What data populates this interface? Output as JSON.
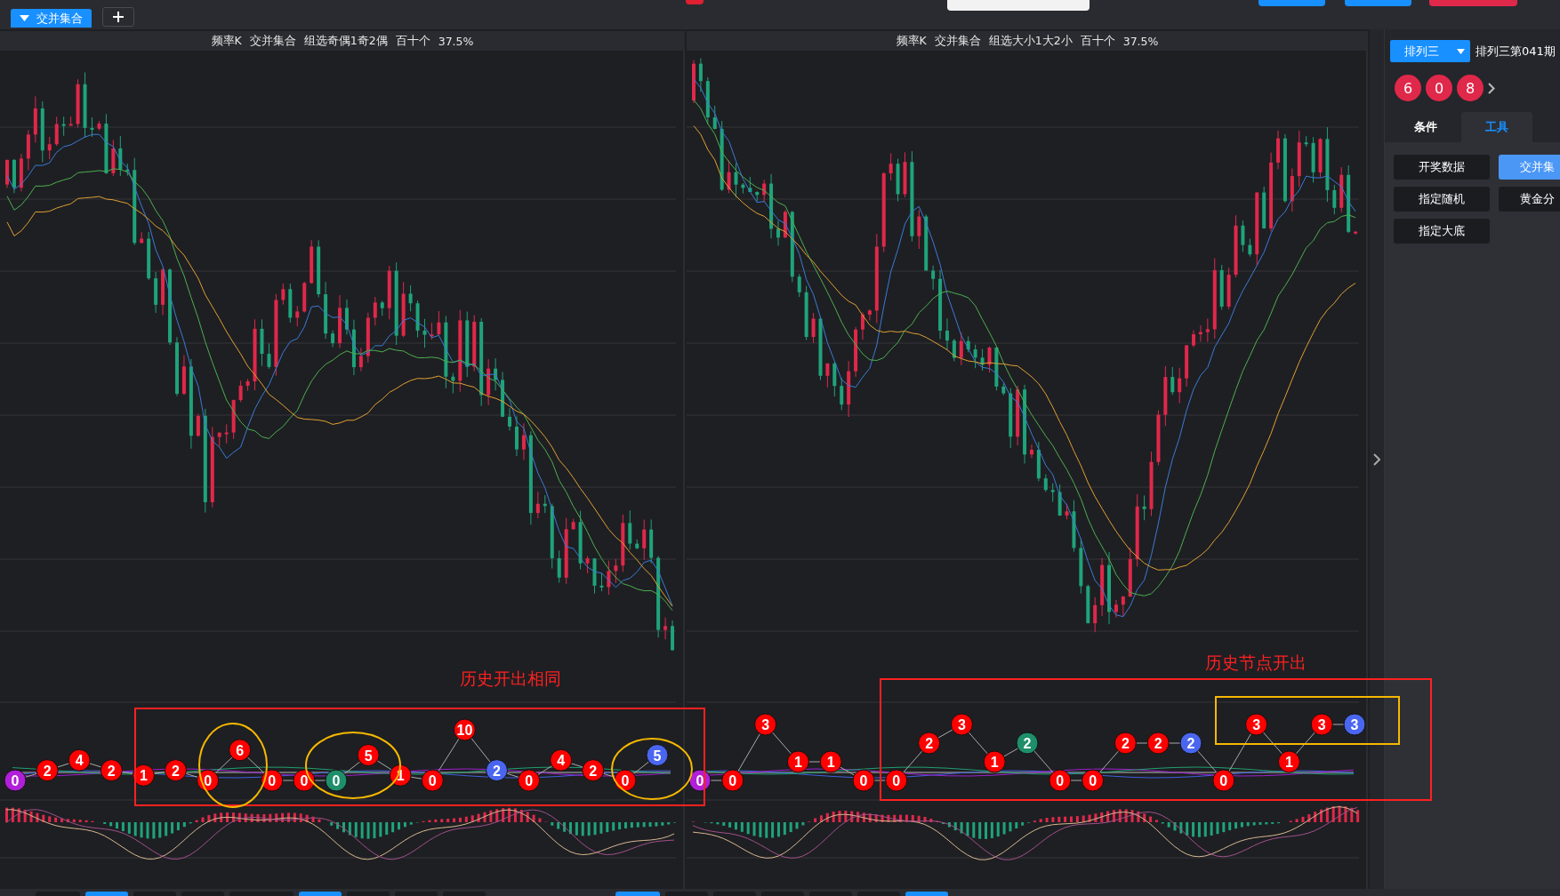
{
  "top_tabs": [
    {
      "label": "交并集合",
      "selected": true
    }
  ],
  "panels": [
    {
      "title_parts": [
        "频率K",
        "交并集合",
        "组选奇偶1奇2偶",
        "百十个",
        "37.5%"
      ],
      "nodes": [
        {
          "label": "0",
          "color": "#b11fd8"
        },
        {
          "label": "2",
          "color": "#ff0000"
        },
        {
          "label": "4",
          "color": "#ff0000"
        },
        {
          "label": "2",
          "color": "#ff0000"
        },
        {
          "label": "1",
          "color": "#ff0000"
        },
        {
          "label": "2",
          "color": "#ff0000"
        },
        {
          "label": "0",
          "color": "#ff0000"
        },
        {
          "label": "6",
          "color": "#ff0000"
        },
        {
          "label": "0",
          "color": "#ff0000"
        },
        {
          "label": "0",
          "color": "#ff0000"
        },
        {
          "label": "0",
          "color": "#1e8f6a"
        },
        {
          "label": "5",
          "color": "#ff0000"
        },
        {
          "label": "1",
          "color": "#ff0000"
        },
        {
          "label": "0",
          "color": "#ff0000"
        },
        {
          "label": "10",
          "color": "#ff0000"
        },
        {
          "label": "2",
          "color": "#4a66f0"
        },
        {
          "label": "0",
          "color": "#ff0000"
        },
        {
          "label": "4",
          "color": "#ff0000"
        },
        {
          "label": "2",
          "color": "#ff0000"
        },
        {
          "label": "0",
          "color": "#ff0000"
        },
        {
          "label": "5",
          "color": "#4a66f0"
        }
      ]
    },
    {
      "title_parts": [
        "频率K",
        "交并集合",
        "组选大小1大2小",
        "百十个",
        "37.5%"
      ],
      "nodes": [
        {
          "label": "0",
          "color": "#b11fd8"
        },
        {
          "label": "0",
          "color": "#ff0000"
        },
        {
          "label": "3",
          "color": "#ff0000"
        },
        {
          "label": "1",
          "color": "#ff0000"
        },
        {
          "label": "1",
          "color": "#ff0000"
        },
        {
          "label": "0",
          "color": "#ff0000"
        },
        {
          "label": "0",
          "color": "#ff0000"
        },
        {
          "label": "2",
          "color": "#ff0000"
        },
        {
          "label": "3",
          "color": "#ff0000"
        },
        {
          "label": "1",
          "color": "#ff0000"
        },
        {
          "label": "2",
          "color": "#1e8f6a"
        },
        {
          "label": "0",
          "color": "#ff0000"
        },
        {
          "label": "0",
          "color": "#ff0000"
        },
        {
          "label": "2",
          "color": "#ff0000"
        },
        {
          "label": "2",
          "color": "#ff0000"
        },
        {
          "label": "2",
          "color": "#4a66f0"
        },
        {
          "label": "0",
          "color": "#ff0000"
        },
        {
          "label": "3",
          "color": "#ff0000"
        },
        {
          "label": "1",
          "color": "#ff0000"
        },
        {
          "label": "3",
          "color": "#ff0000"
        },
        {
          "label": "3",
          "color": "#4a66f0"
        }
      ]
    }
  ],
  "annotations": [
    "历史开出相同",
    "历史节点开出"
  ],
  "sidebar": {
    "lottery_select": "排列三",
    "issue": "排列三第041期",
    "balls": [
      "6",
      "0",
      "8"
    ],
    "tabs": [
      {
        "label": "条件",
        "selected": false
      },
      {
        "label": "工具",
        "selected": true
      }
    ],
    "tools": [
      {
        "label": "开奖数据",
        "selected": false
      },
      {
        "label": "交并集",
        "selected": true
      },
      {
        "label": "指定随机",
        "selected": false
      },
      {
        "label": "黄金分",
        "selected": false
      },
      {
        "label": "指定大底",
        "selected": false
      }
    ]
  }
}
